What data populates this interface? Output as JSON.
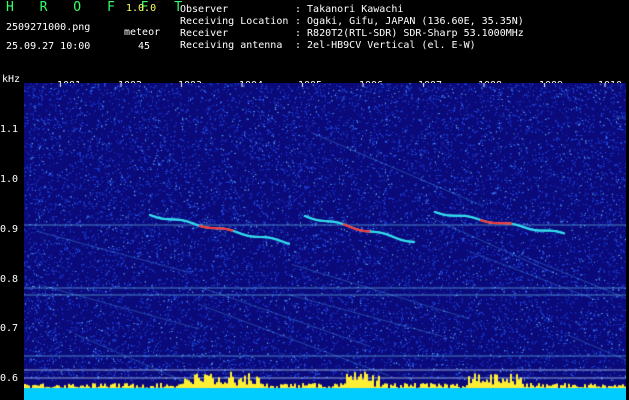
{
  "header": {
    "app_name": "H R O F F T",
    "version": "1.0.0",
    "filename": "2509271000.png",
    "datetime": "25.09.27 10:00",
    "count_label": "meteor",
    "count_value": "45",
    "info": [
      {
        "key": "Observer",
        "value": ": Takanori Kawachi"
      },
      {
        "key": "Receiving Location",
        "value": ": Ogaki, Gifu, JAPAN (136.60E, 35.35N)"
      },
      {
        "key": "Receiver",
        "value": ": R820T2(RTL-SDR) SDR-Sharp 53.1000MHz"
      },
      {
        "key": "Receiving antenna",
        "value": ": 2el-HB9CV Vertical (el. E-W)"
      }
    ]
  },
  "plot": {
    "y_unit": "kHz",
    "x_ticks": [
      "1001",
      "1002",
      "1003",
      "1004",
      "1005",
      "1006",
      "1007",
      "1008",
      "1009",
      "1010"
    ],
    "y_ticks": [
      "1.1",
      "1.0",
      "0.9",
      "0.8",
      "0.7",
      "0.6"
    ],
    "colors": {
      "background": "#0a0a7a",
      "noise": "#2a5cff",
      "trace": "#33ddee",
      "hot": "#ff3333",
      "baseline": "#00ccff",
      "spikes": "#ffee33"
    }
  }
}
